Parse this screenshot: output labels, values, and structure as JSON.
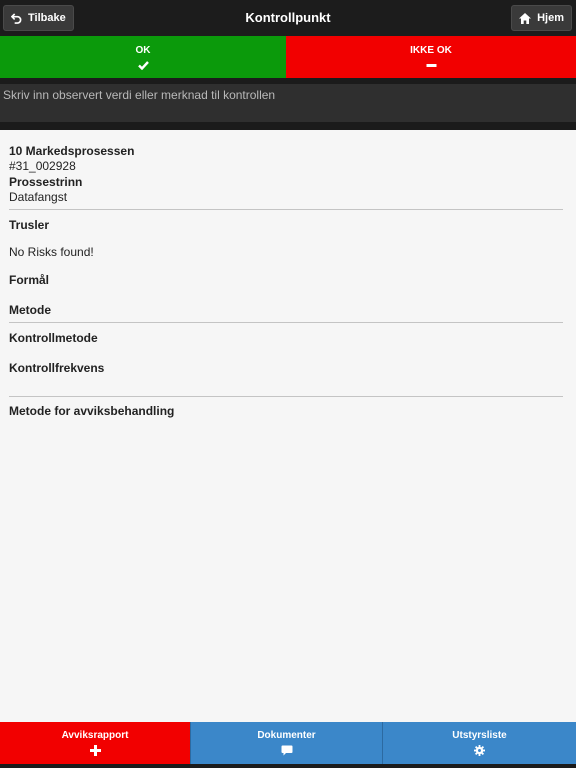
{
  "header": {
    "back_label": "Tilbake",
    "title": "Kontrollpunkt",
    "home_label": "Hjem"
  },
  "status": {
    "ok_label": "OK",
    "not_ok_label": "IKKE OK",
    "ok_color": "#0b9a0b",
    "not_ok_color": "#f20000"
  },
  "note": {
    "placeholder": "Skriv inn observert verdi eller merknad til kontrollen",
    "value": ""
  },
  "details": {
    "process_name": "10 Markedsprosessen",
    "process_id": "#31_002928",
    "step_heading": "Prossestrinn",
    "step_value": "Datafangst",
    "threats_heading": "Trusler",
    "threats_value": "No Risks found!",
    "purpose_heading": "Formål",
    "method_heading": "Metode",
    "control_method_heading": "Kontrollmetode",
    "control_frequency_heading": "Kontrollfrekvens",
    "deviation_method_heading": "Metode for avviksbehandling"
  },
  "tabs": {
    "deviation_report_label": "Avviksrapport",
    "documents_label": "Dokumenter",
    "equipment_label": "Utstyrsliste",
    "accent_red": "#f20000",
    "accent_blue": "#3b87c9"
  }
}
